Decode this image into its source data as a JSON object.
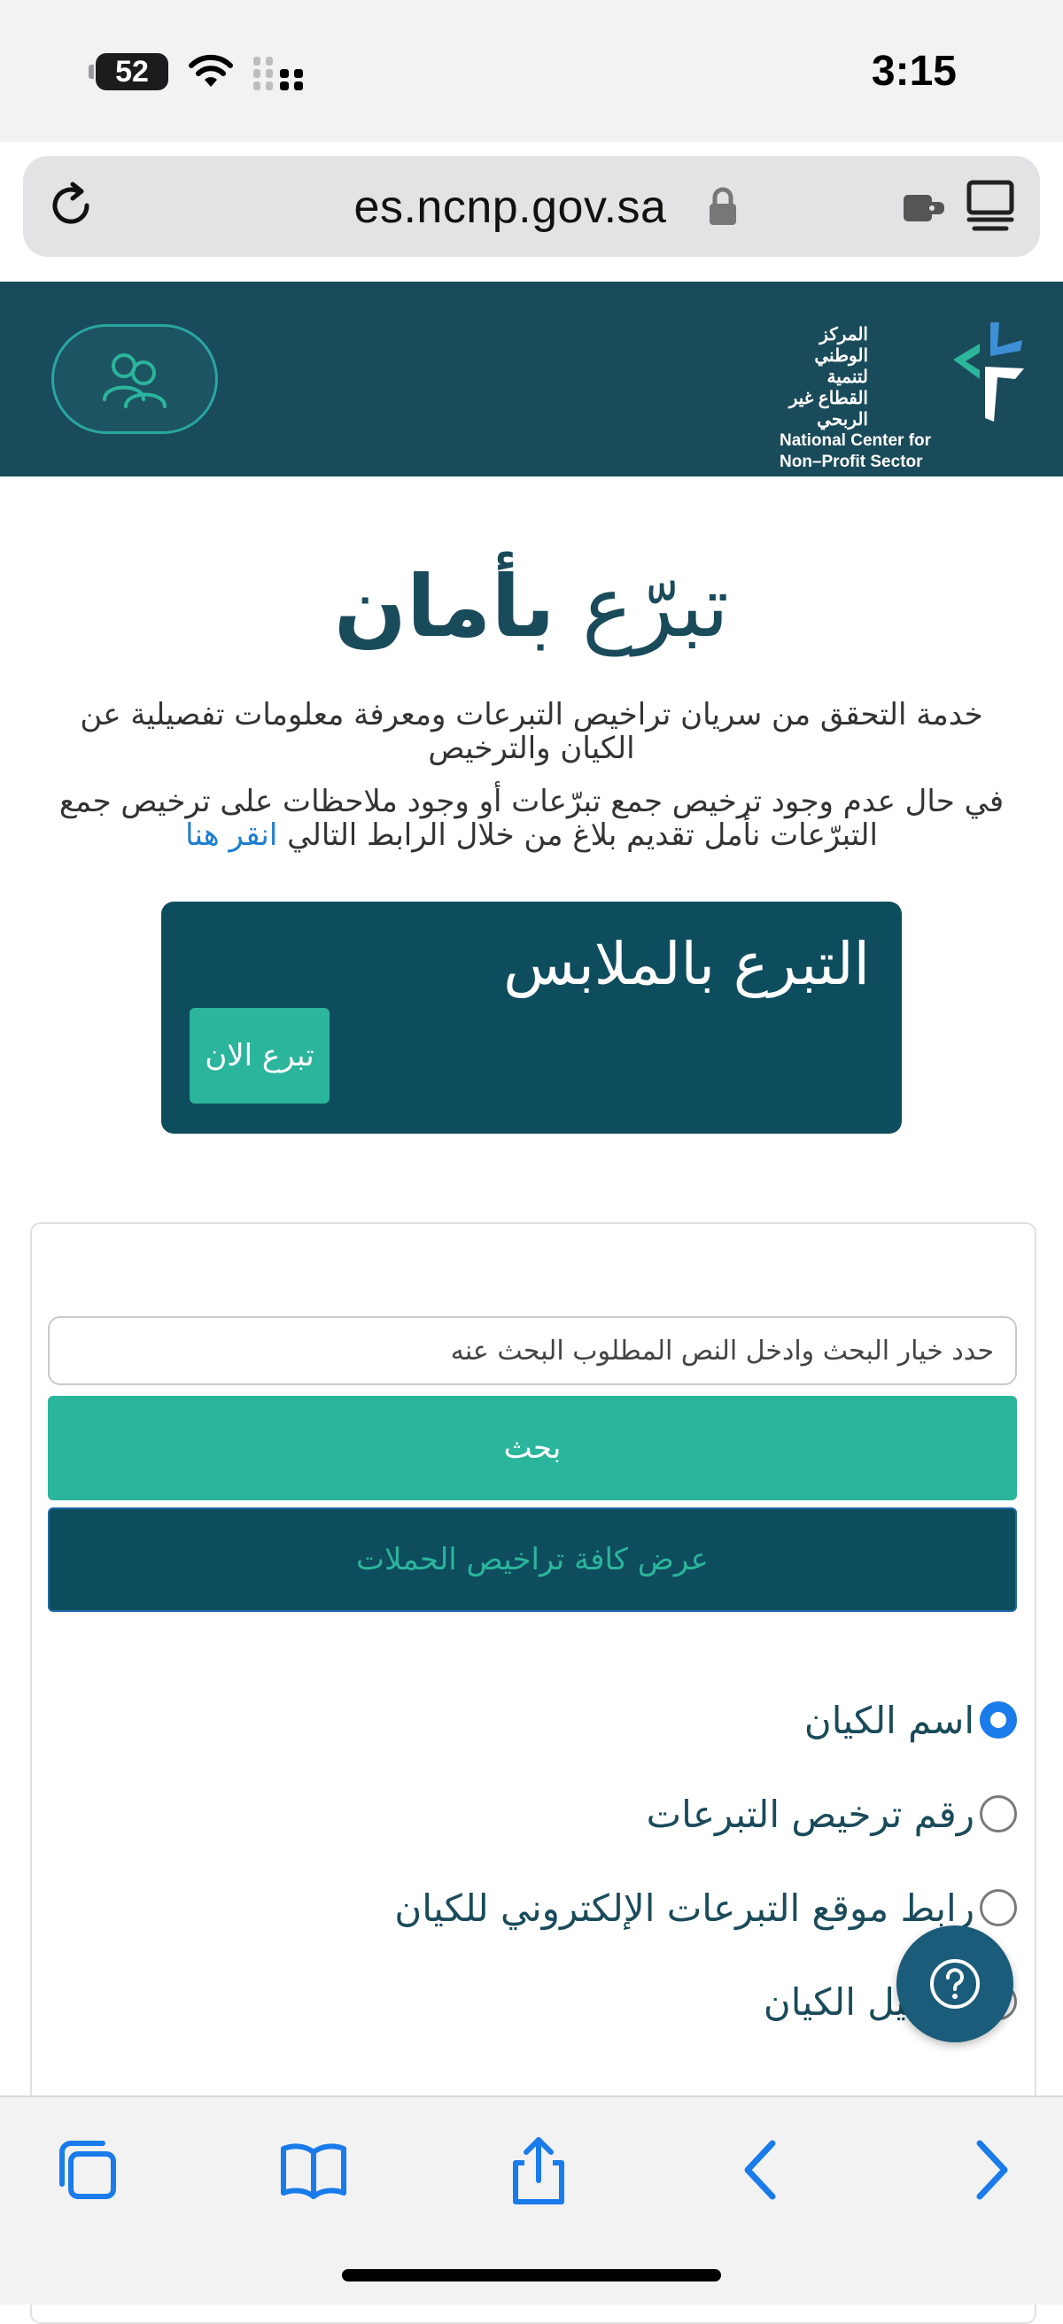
{
  "status_bar": {
    "battery": "52",
    "time": "3:15"
  },
  "browser": {
    "url": "es.ncnp.gov.sa"
  },
  "header": {
    "logo": {
      "arabic_line1": "المركز الوطني لتنمية",
      "arabic_line2": "القطاع غير الربحي",
      "english_line1": "National Center for",
      "english_line2": "Non–Profit Sector"
    }
  },
  "hero": {
    "title_light": "تبرّع",
    "title_bold": "بأمان",
    "description": "خدمة التحقق من سريان تراخيص التبرعات ومعرفة معلومات تفصيلية عن الكيان والترخيص",
    "note": "في حال عدم وجود ترخيص جمع تبرّعات أو وجود ملاحظات على ترخيص جمع التبرّعات نأمل تقديم بلاغ من خلال الرابط التالي",
    "note_link": "انقر هنا"
  },
  "banner": {
    "title": "التبرع بالملابس",
    "button": "تبرع الان"
  },
  "search": {
    "placeholder": "حدد خيار البحث وادخل النص المطلوب البحث عنه",
    "search_button": "بحث",
    "campaigns_button": "عرض كافة تراخيص الحملات",
    "options": [
      {
        "label": "اسم الكيان",
        "checked": true
      },
      {
        "label": "رقم ترخيص التبرعات",
        "checked": false
      },
      {
        "label": "رابط موقع التبرعات الإلكتروني للكيان",
        "checked": false
      },
      {
        "label": "تسجيل الكيان",
        "checked": false
      }
    ]
  },
  "colors": {
    "header_bg": "#1a4b5a",
    "banner_bg": "#0e4d5e",
    "accent_green": "#2bb59c",
    "link_blue": "#1f7fcf",
    "ios_blue": "#1a7bea"
  },
  "toolbar": {
    "icons": [
      "tabs-icon",
      "bookmarks-icon",
      "share-icon",
      "back-icon",
      "forward-icon"
    ]
  }
}
